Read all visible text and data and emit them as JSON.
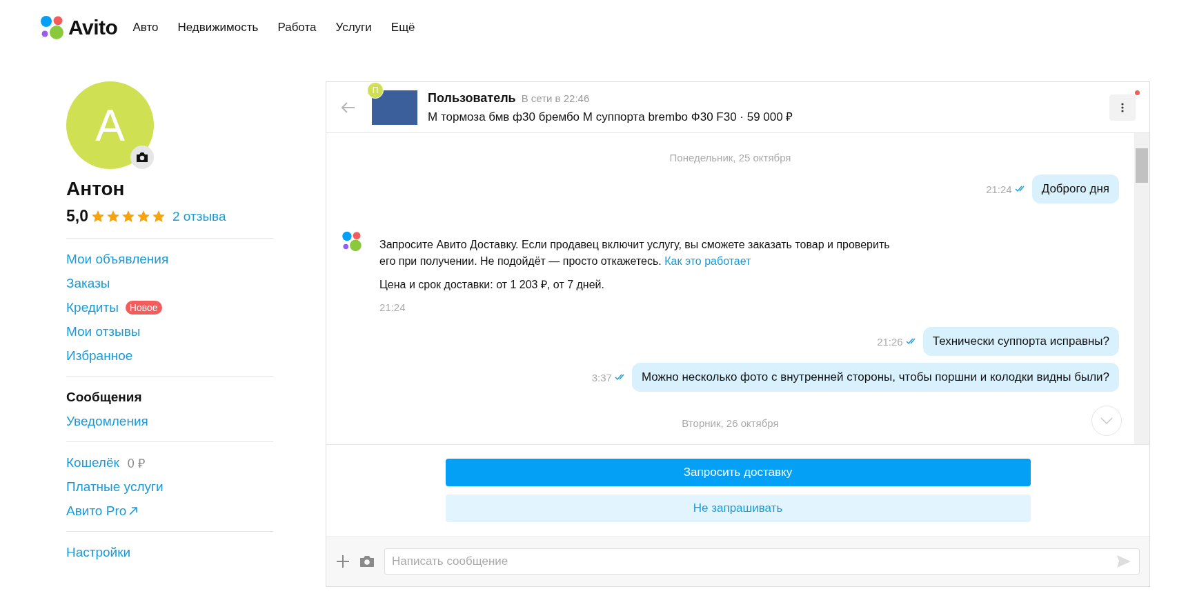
{
  "header": {
    "logo": "Avito",
    "nav": [
      "Авто",
      "Недвижимость",
      "Работа",
      "Услуги",
      "Ещё"
    ]
  },
  "profile": {
    "avatar_letter": "А",
    "name": "Антон",
    "rating": "5,0",
    "stars": 5,
    "reviews": "2 отзыва"
  },
  "sidebar": {
    "groups": [
      [
        {
          "label": "Мои объявления",
          "selected": false
        },
        {
          "label": "Заказы",
          "selected": false
        },
        {
          "label": "Кредиты",
          "badge": "Новое",
          "selected": false
        },
        {
          "label": "Мои отзывы",
          "selected": false
        },
        {
          "label": "Избранное",
          "selected": false
        }
      ],
      [
        {
          "label": "Сообщения",
          "selected": true
        },
        {
          "label": "Уведомления",
          "selected": false
        }
      ],
      [
        {
          "label": "Кошелёк",
          "extra": "0 ₽",
          "selected": false
        },
        {
          "label": "Платные услуги",
          "selected": false
        },
        {
          "label": "Авито Pro",
          "external": true,
          "selected": false
        }
      ],
      [
        {
          "label": "Настройки",
          "selected": false
        }
      ]
    ]
  },
  "chat": {
    "user_initial": "П",
    "user": "Пользователь",
    "status": "В сети в 22:46",
    "item": "М тормоза бмв ф30 брембо М суппорта brembo Ф30 F30 · 59 000 ₽",
    "unread": true,
    "messages": [
      {
        "kind": "date",
        "text": "Понедельник, 25 октября"
      },
      {
        "kind": "outgoing",
        "text": "Доброго дня",
        "time": "21:24",
        "read": true
      },
      {
        "kind": "system",
        "text": "Запросите Авито Доставку. Если продавец включит услугу, вы сможете заказать товар и проверить его при получении. Не подойдёт — просто откажетесь.",
        "link": "Как это работает",
        "note": "Цена и срок доставки: от 1 203 ₽, от 7 дней.",
        "time": "21:24"
      },
      {
        "kind": "outgoing",
        "text": "Технически суппорта исправны?",
        "time": "21:26",
        "read": true
      },
      {
        "kind": "outgoing",
        "text": "Можно несколько фото с внутренней стороны, чтобы поршни и колодки видны были?",
        "time": "3:37",
        "read": true
      },
      {
        "kind": "date",
        "text": "Вторник, 26 октября"
      }
    ],
    "actions": [
      {
        "label": "Запросить доставку",
        "kind": "primary"
      },
      {
        "label": "Не запрашивать",
        "kind": "secondary"
      }
    ],
    "input": {
      "placeholder": "Написать сообщение"
    }
  }
}
